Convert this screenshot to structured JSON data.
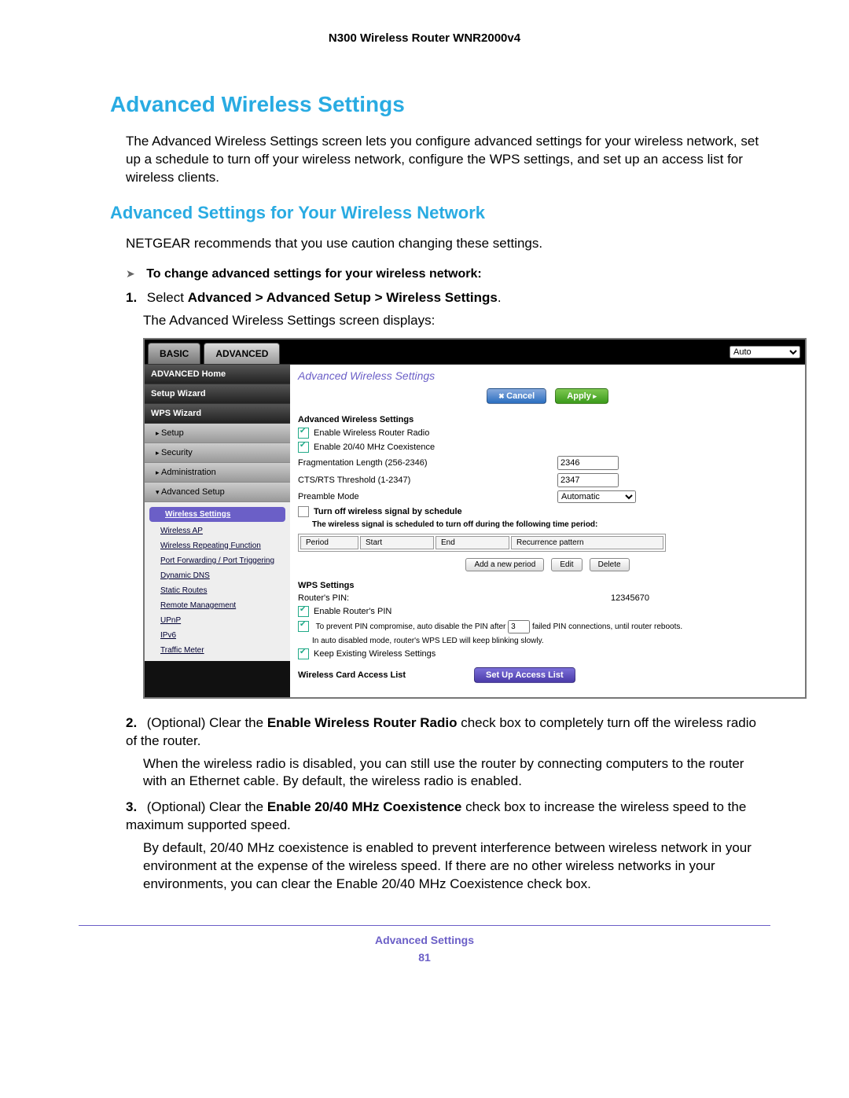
{
  "header": {
    "model": "N300 Wireless Router WNR2000v4"
  },
  "section": {
    "h1": "Advanced Wireless Settings",
    "intro": "The Advanced Wireless Settings screen lets you configure advanced settings for your wireless network, set up a schedule to turn off your wireless network, configure the WPS settings, and set up an access list for wireless clients.",
    "h2": "Advanced Settings for Your Wireless Network",
    "caution": "NETGEAR recommends that you use caution changing these settings.",
    "task_lead": "To change advanced settings for your wireless network:",
    "step1_a": "Select ",
    "step1_b": "Advanced > Advanced Setup > Wireless Settings",
    "step1_c": ".",
    "step1_after": "The Advanced Wireless Settings screen displays:",
    "step2_a": "(Optional) Clear the ",
    "step2_b": "Enable Wireless Router Radio",
    "step2_c": " check box to completely turn off the wireless radio of the router.",
    "step2_after": "When the wireless radio is disabled, you can still use the router by connecting computers to the router with an Ethernet cable. By default, the wireless radio is enabled.",
    "step3_a": "(Optional) Clear the ",
    "step3_b": "Enable 20/40 MHz Coexistence",
    "step3_c": " check box to increase the wireless speed to the maximum supported speed.",
    "step3_after": "By default, 20/40 MHz coexistence is enabled to prevent interference between wireless network in your environment at the expense of the wireless speed. If there are no other wireless networks in your environments, you can clear the Enable 20/40 MHz Coexistence check box."
  },
  "ui": {
    "top_tabs": {
      "basic": "BASIC",
      "advanced": "ADVANCED"
    },
    "auto": "Auto",
    "sidebar": {
      "home": "ADVANCED Home",
      "setup_wizard": "Setup Wizard",
      "wps_wizard": "WPS Wizard",
      "setup": "Setup",
      "security": "Security",
      "admin": "Administration",
      "adv_setup": "Advanced Setup",
      "subs": {
        "wireless_settings": "Wireless Settings",
        "wireless_ap": "Wireless AP",
        "wrf": "Wireless Repeating Function",
        "pf": "Port Forwarding / Port Triggering",
        "ddns": "Dynamic DNS",
        "static": "Static Routes",
        "remote": "Remote Management",
        "upnp": "UPnP",
        "ipv6": "IPv6",
        "traffic": "Traffic Meter"
      }
    },
    "main": {
      "title": "Advanced Wireless Settings",
      "cancel": "Cancel",
      "apply": "Apply",
      "sec1": "Advanced Wireless Settings",
      "ck_radio": "Enable Wireless Router Radio",
      "ck_coex": "Enable 20/40 MHz Coexistence",
      "frag_label": "Fragmentation Length (256-2346)",
      "frag_val": "2346",
      "cts_label": "CTS/RTS Threshold (1-2347)",
      "cts_val": "2347",
      "preamble_label": "Preamble Mode",
      "preamble_val": "Automatic",
      "ck_sched": "Turn off wireless signal by schedule",
      "sched_note": "The wireless signal is scheduled to turn off during the following time period:",
      "th_period": "Period",
      "th_start": "Start",
      "th_end": "End",
      "th_rec": "Recurrence pattern",
      "btn_add": "Add a new period",
      "btn_edit": "Edit",
      "btn_del": "Delete",
      "sec2": "WPS Settings",
      "pin_label": "Router's PIN:",
      "pin_val": "12345670",
      "ck_pin": "Enable Router's PIN",
      "pin_note_a": "To prevent PIN compromise, auto disable the PIN after ",
      "pin_note_val": "3",
      "pin_note_b": " failed PIN connections, until router reboots.",
      "pin_note2": "In auto disabled mode, router's WPS LED will keep blinking slowly.",
      "ck_keep": "Keep Existing Wireless Settings",
      "sec3": "Wireless Card Access List",
      "btn_access": "Set Up Access List"
    }
  },
  "footer": {
    "label": "Advanced Settings",
    "page": "81"
  }
}
